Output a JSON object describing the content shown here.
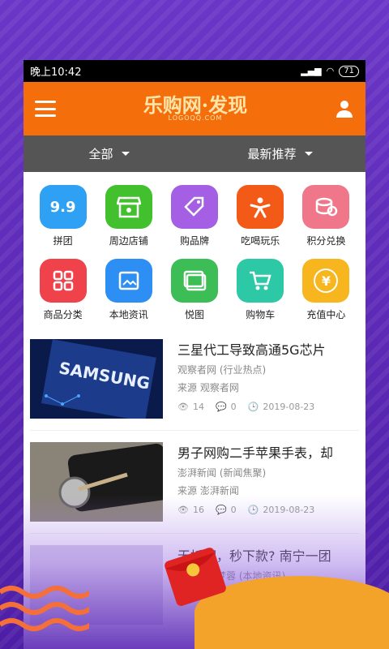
{
  "status": {
    "time": "晚上10:42",
    "battery": "71"
  },
  "appbar": {
    "brand": "乐购网·发现",
    "brand_sub": "LOGOQQ.COM"
  },
  "filters": [
    "全部",
    "最新推荐"
  ],
  "grid": [
    {
      "label": "拼团",
      "icon": "group-buy-icon",
      "color": "#2ea1f5",
      "glyph": "9.9"
    },
    {
      "label": "周边店铺",
      "icon": "store-icon",
      "color": "#42c02e",
      "glyph": ""
    },
    {
      "label": "购品牌",
      "icon": "tag-icon",
      "color": "#a45fe4",
      "glyph": ""
    },
    {
      "label": "吃喝玩乐",
      "icon": "fun-icon",
      "color": "#f35a17",
      "glyph": ""
    },
    {
      "label": "积分兑换",
      "icon": "coin-icon",
      "color": "#f0768a",
      "glyph": ""
    },
    {
      "label": "商品分类",
      "icon": "category-icon",
      "color": "#f0424a",
      "glyph": ""
    },
    {
      "label": "本地资讯",
      "icon": "news-icon",
      "color": "#2d8ff3",
      "glyph": ""
    },
    {
      "label": "悦图",
      "icon": "gallery-icon",
      "color": "#3dbd56",
      "glyph": ""
    },
    {
      "label": "购物车",
      "icon": "cart-icon",
      "color": "#2dc9a6",
      "glyph": ""
    },
    {
      "label": "充值中心",
      "icon": "recharge-icon",
      "color": "#f7b51e",
      "glyph": "¥"
    }
  ],
  "news": [
    {
      "title": "三星代工导致高通5G芯片",
      "source_line": "观察者网  (行业热点)",
      "origin": "来源  观察者网",
      "views": "14",
      "comments": "0",
      "date": "2019-08-23"
    },
    {
      "title": "男子网购二手苹果手表，却",
      "source_line": "澎湃新闻  (新闻焦聚)",
      "origin": "来源  澎湃新闻",
      "views": "16",
      "comments": "0",
      "date": "2019-08-23"
    },
    {
      "title": "无抵押，秒下款? 南宁一团",
      "source_line": "丰东、班梦蓉  (本地资讯)",
      "origin": "",
      "views": "",
      "comments": "",
      "date": ""
    }
  ]
}
